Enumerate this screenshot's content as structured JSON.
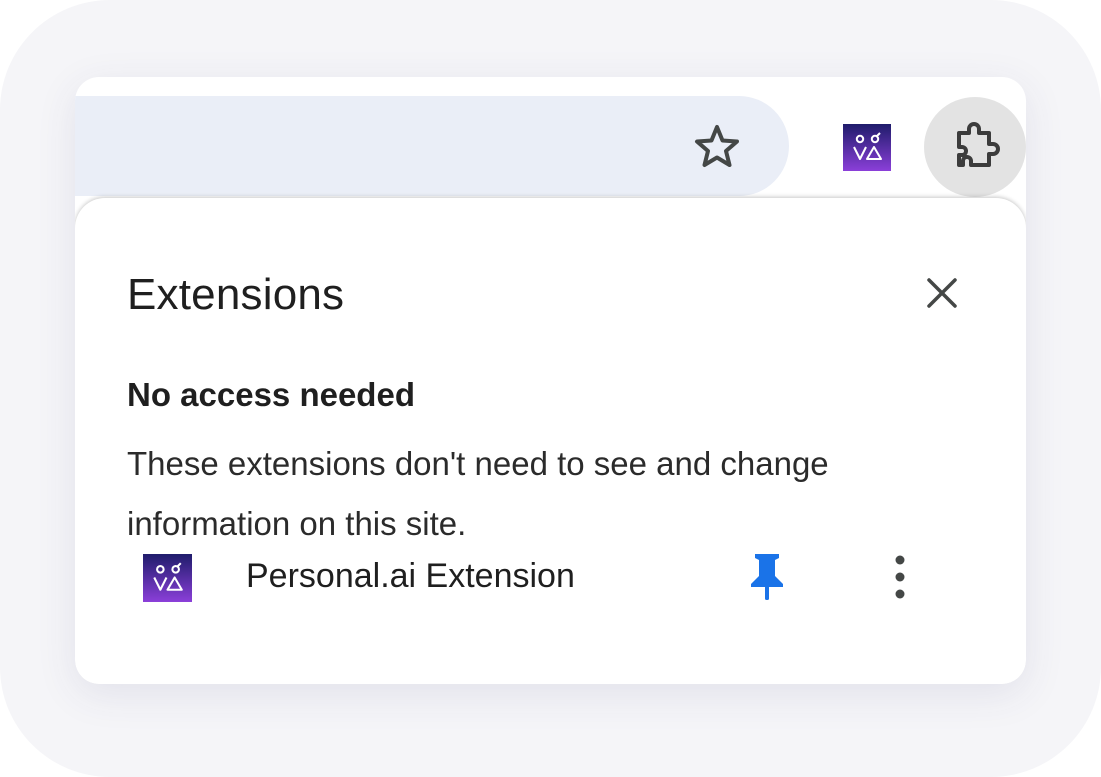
{
  "toolbar": {
    "bookmark_icon": "star-outline-icon",
    "pinned_extension_icon": "personal-ai-logo",
    "extensions_menu_icon": "puzzle-piece-icon"
  },
  "popup": {
    "title": "Extensions",
    "close_icon": "close-icon",
    "section": {
      "heading": "No access needed",
      "description": "These extensions don't need to see and change information on this site."
    },
    "extensions": [
      {
        "name": "Personal.ai Extension",
        "icon": "personal-ai-logo",
        "pinned": true,
        "pin_icon": "pin-icon",
        "more_icon": "more-vert-icon"
      }
    ]
  },
  "colors": {
    "omnibox_bg": "#eaeef7",
    "pin_blue": "#1a73e8",
    "logo_gradient_top": "#1f1c6b",
    "logo_gradient_bottom": "#8b3fd9",
    "puzzle_button_bg": "#e3e3e3"
  }
}
